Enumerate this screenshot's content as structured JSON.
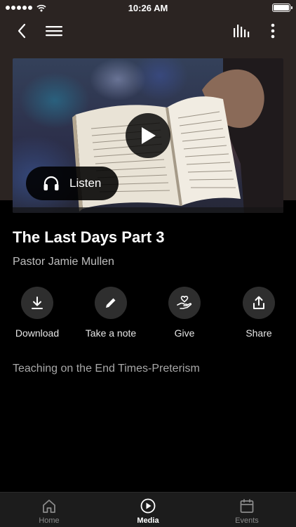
{
  "status_bar": {
    "time": "10:26 AM"
  },
  "media": {
    "listen_label": "Listen",
    "title": "The Last Days Part 3",
    "speaker": "Pastor Jamie Mullen",
    "description": "Teaching on the End Times-Preterism"
  },
  "actions": [
    {
      "label": "Download",
      "icon": "download-icon"
    },
    {
      "label": "Take a note",
      "icon": "pencil-icon"
    },
    {
      "label": "Give",
      "icon": "give-hand-heart-icon"
    },
    {
      "label": "Share",
      "icon": "share-icon"
    }
  ],
  "tabs": [
    {
      "label": "Home",
      "icon": "home-icon",
      "active": false
    },
    {
      "label": "Media",
      "icon": "play-circle-icon",
      "active": true
    },
    {
      "label": "Events",
      "icon": "calendar-icon",
      "active": false
    }
  ],
  "colors": {
    "background": "#000000",
    "header_background": "#2b2422",
    "tab_bar_background": "#1c1c1c",
    "tab_inactive": "#8a8a8a",
    "tab_active": "#ffffff"
  }
}
